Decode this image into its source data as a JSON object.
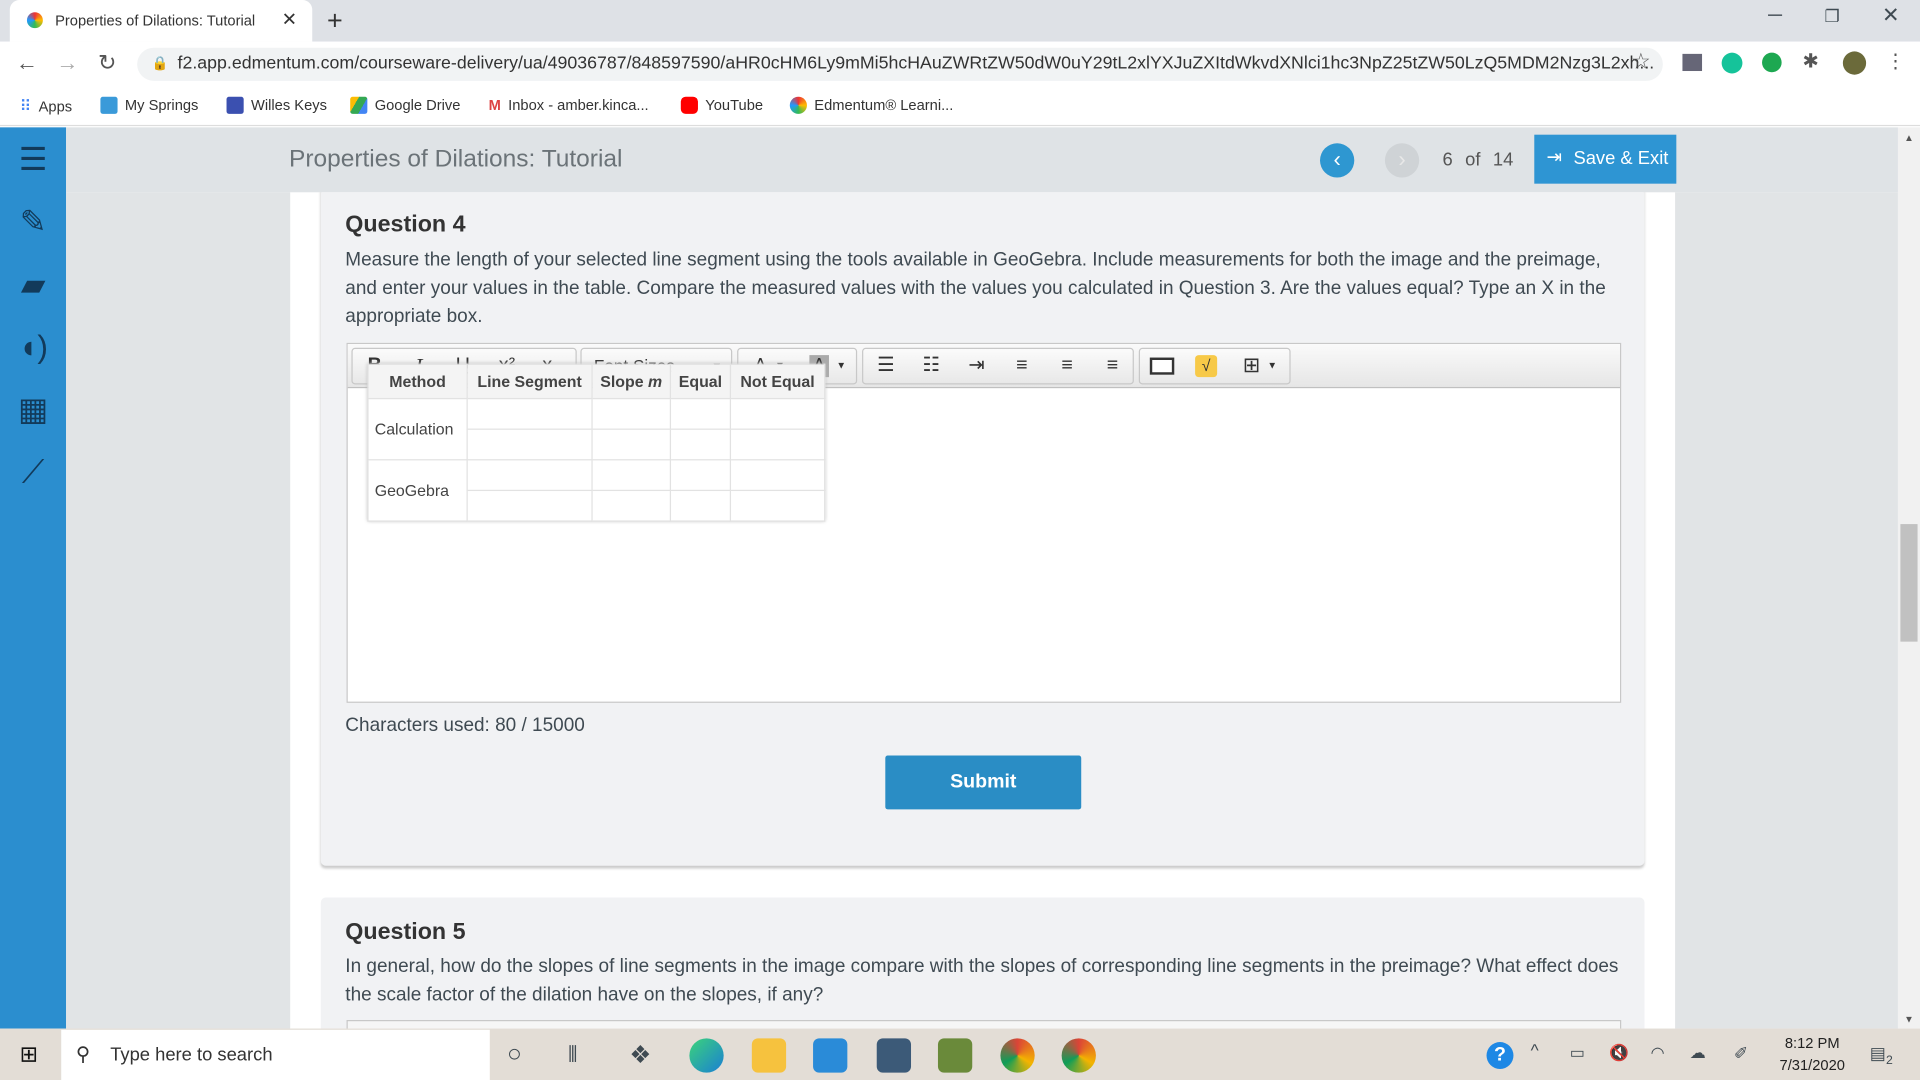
{
  "browser": {
    "tab_title": "Properties of Dilations: Tutorial",
    "url": "f2.app.edmentum.com/courseware-delivery/ua/49036787/848597590/aHR0cHM6Ly9mMi5hcHAuZWRtZW50dW0uY29tL2xlYXJuZXItdWkvdXNlci1hc3NpZ25tZW50LzQ5MDM2Nzg3L2xh...",
    "bookmarks": [
      "Apps",
      "My Springs",
      "Willes Keys",
      "Google Drive",
      "Inbox - amber.kinca...",
      "YouTube",
      "Edmentum® Learni..."
    ]
  },
  "header": {
    "title": "Properties of Dilations: Tutorial",
    "page_current": "6",
    "page_of": "of",
    "page_total": "14",
    "save_exit": "Save & Exit"
  },
  "sidebar": {
    "items": [
      "list-icon",
      "notes-icon",
      "folder-icon",
      "audio-icon",
      "calculator-icon",
      "graph-icon"
    ]
  },
  "q4": {
    "title": "Question 4",
    "prompt": "Measure the length of your selected line segment using the tools available in GeoGebra. Include measurements for both the image and the preimage, and enter your values in the table. Compare the measured values with the values you calculated in Question 3. Are the values equal? Type an X in the appropriate box.",
    "toolbar": {
      "bold": "B",
      "italic": "I",
      "underline": "U",
      "font_sizes": "Font Sizes",
      "font_color": "A",
      "bg_color": "A"
    },
    "table": {
      "headers": [
        "Method",
        "Line Segment",
        "Slope ",
        "Equal",
        "Not Equal"
      ],
      "slope_var": "m",
      "rows": [
        "Calculation",
        "GeoGebra"
      ]
    },
    "chars_used": "Characters used: 80 / 15000",
    "submit": "Submit"
  },
  "q5": {
    "title": "Question 5",
    "prompt": "In general, how do the slopes of line segments in the image compare with the slopes of corresponding line segments in the preimage? What effect does the scale factor of the dilation have on the slopes, if any?"
  },
  "taskbar": {
    "search_placeholder": "Type here to search",
    "time": "8:12 PM",
    "date": "7/31/2020",
    "notifications": "2"
  },
  "colors": {
    "accent": "#2b8ecf",
    "submit": "#2a8dc5",
    "card": "#f1f2f4"
  }
}
